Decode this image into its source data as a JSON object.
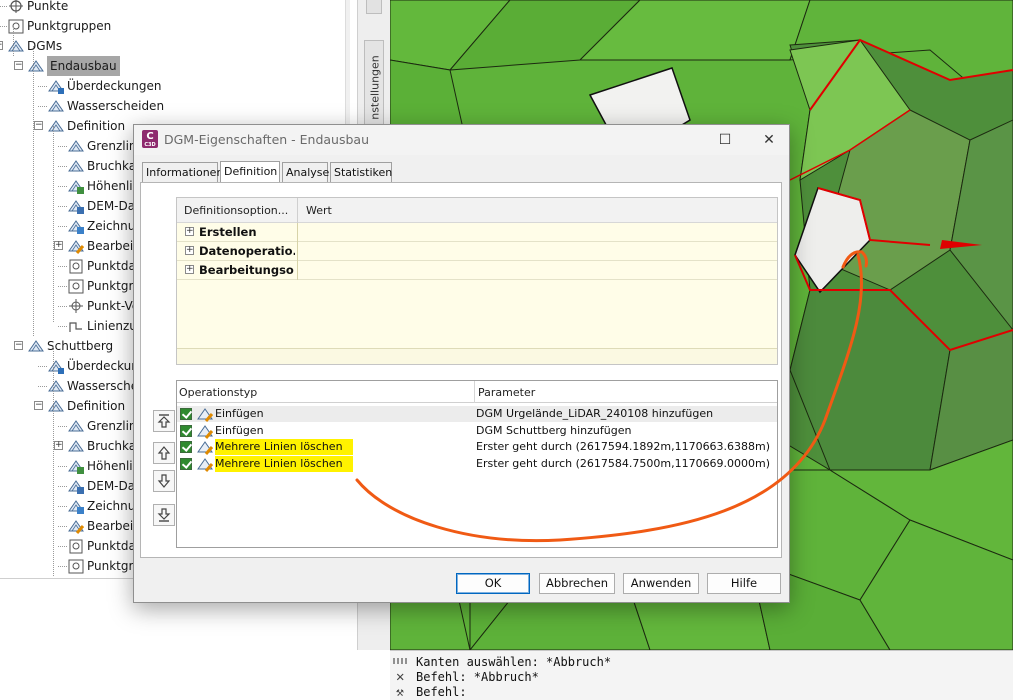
{
  "tree": {
    "items": [
      {
        "label": "Punkte",
        "icon": "points-icon"
      },
      {
        "label": "Punktgruppen",
        "icon": "point-groups-icon"
      },
      {
        "label": "DGMs",
        "icon": "surface-icon"
      },
      {
        "label": "Endausbau",
        "icon": "surface-icon",
        "selected": true
      },
      {
        "label": "Überdeckungen",
        "icon": "masks-icon"
      },
      {
        "label": "Wasserscheiden",
        "icon": "watersheds-icon"
      },
      {
        "label": "Definition",
        "icon": "definition-icon"
      },
      {
        "label": "Grenzlini",
        "icon": "boundaries-icon"
      },
      {
        "label": "Bruchkar",
        "icon": "breaklines-icon"
      },
      {
        "label": "Höhenlin",
        "icon": "contours-icon"
      },
      {
        "label": "DEM-Dat",
        "icon": "dem-files-icon"
      },
      {
        "label": "Zeichnur",
        "icon": "drawing-objects-icon"
      },
      {
        "label": "Bearbeitu",
        "icon": "edits-icon"
      },
      {
        "label": "Punktdat",
        "icon": "point-files-icon"
      },
      {
        "label": "Punktgru",
        "icon": "point-groups-icon"
      },
      {
        "label": "Punkt-Ve",
        "icon": "point-survey-icon"
      },
      {
        "label": "Linienzug",
        "icon": "polyline-icon"
      },
      {
        "label": "Schuttberg",
        "icon": "surface-icon"
      },
      {
        "label": "Überdeckun",
        "icon": "masks-icon"
      },
      {
        "label": "Wasserschei",
        "icon": "watersheds-icon"
      },
      {
        "label": "Definition",
        "icon": "definition-icon"
      },
      {
        "label": "Grenzlini",
        "icon": "boundaries-icon"
      },
      {
        "label": "Bruchkar",
        "icon": "breaklines-icon"
      },
      {
        "label": "Höhenlin",
        "icon": "contours-icon"
      },
      {
        "label": "DEM-Dat",
        "icon": "dem-files-icon"
      },
      {
        "label": "Zeichnur",
        "icon": "drawing-objects-icon"
      },
      {
        "label": "Bearbeitu",
        "icon": "edits-icon"
      },
      {
        "label": "Punktdat",
        "icon": "point-files-icon"
      },
      {
        "label": "Punktgru",
        "icon": "point-groups-icon"
      }
    ]
  },
  "side_tab": {
    "label": "nstellungen"
  },
  "dialog": {
    "title": "DGM-Eigenschaften - Endausbau",
    "app_icon_letter": "C",
    "app_icon_sub": "C3D",
    "tabs": [
      "Informationen",
      "Definition",
      "Analyse",
      "Statistiken"
    ],
    "active_tab": "Definition",
    "definition_grid": {
      "headers": [
        "Definitionsoption...",
        "Wert"
      ],
      "rows": [
        "Erstellen",
        "Datenoperatio...",
        "Bearbeitungso..."
      ]
    },
    "operations": {
      "headers": [
        "Operationstyp",
        "Parameter"
      ],
      "rows": [
        {
          "type": "Einfügen",
          "parameter": "DGM Urgelände_LiDAR_240108 hinzufügen",
          "checked": true,
          "highlighted": false
        },
        {
          "type": "Einfügen",
          "parameter": "DGM Schuttberg hinzufügen",
          "checked": true,
          "highlighted": false
        },
        {
          "type": "Mehrere Linien löschen",
          "parameter": "Erster geht durch (2617594.1892m,1170663.6388m)",
          "checked": true,
          "highlighted": true
        },
        {
          "type": "Mehrere Linien löschen",
          "parameter": "Erster geht durch (2617584.7500m,1170669.0000m)",
          "checked": true,
          "highlighted": true
        }
      ]
    },
    "buttons": {
      "ok": "OK",
      "cancel": "Abbrechen",
      "apply": "Anwenden",
      "help": "Hilfe"
    }
  },
  "command_line": {
    "lines": [
      "Kanten auswählen: *Abbruch*",
      "Befehl: *Abbruch*",
      "Befehl:"
    ]
  },
  "colors": {
    "highlight": "#fff200",
    "annotation_arrow": "#f05a14",
    "terrain_green": "#5fb33a",
    "boundary_red": "#e00000",
    "selection_gray": "#a6a6a6"
  }
}
